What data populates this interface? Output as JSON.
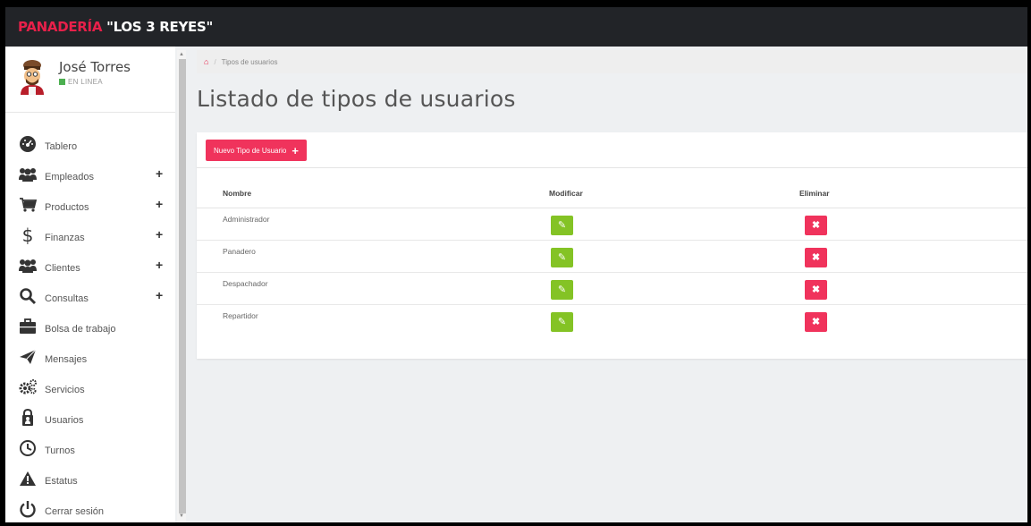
{
  "topbar": {
    "brand_part1": "PANADERÍA",
    "brand_part2": "\"LOS 3 REYES\""
  },
  "colors": {
    "brand_red": "#e8204a",
    "edit_green": "#84c325",
    "delete_red": "#f0335c",
    "topbar": "#222428"
  },
  "user": {
    "name": "José Torres",
    "status": "EN LINEA",
    "avatar_icon": "baker-avatar"
  },
  "menu": [
    {
      "label": "Tablero",
      "icon": "dashboard-icon",
      "expandable": false
    },
    {
      "label": "Empleados",
      "icon": "users-icon",
      "expandable": true
    },
    {
      "label": "Productos",
      "icon": "cart-icon",
      "expandable": true
    },
    {
      "label": "Finanzas",
      "icon": "dollar-icon",
      "expandable": true
    },
    {
      "label": "Clientes",
      "icon": "users-icon",
      "expandable": true
    },
    {
      "label": "Consultas",
      "icon": "search-icon",
      "expandable": true
    },
    {
      "label": "Bolsa de trabajo",
      "icon": "briefcase-icon",
      "expandable": false
    },
    {
      "label": "Mensajes",
      "icon": "paper-plane-icon",
      "expandable": false
    },
    {
      "label": "Servicios",
      "icon": "gears-icon",
      "expandable": false
    },
    {
      "label": "Usuarios",
      "icon": "user-lock-icon",
      "expandable": false
    },
    {
      "label": "Turnos",
      "icon": "clock-icon",
      "expandable": false
    },
    {
      "label": "Estatus",
      "icon": "warning-icon",
      "expandable": false
    },
    {
      "label": "Cerrar sesión",
      "icon": "power-icon",
      "expandable": false
    }
  ],
  "menu_plus": "+",
  "breadcrumb": {
    "current": "Tipos de usuarios"
  },
  "page": {
    "title": "Listado de tipos de usuarios"
  },
  "toolbar": {
    "new_label": "Nuevo Tipo de Usuario",
    "new_icon": "+"
  },
  "table": {
    "headers": [
      "Nombre",
      "Modificar",
      "Eliminar"
    ],
    "rows": [
      {
        "name": "Administrador"
      },
      {
        "name": "Panadero"
      },
      {
        "name": "Despachador"
      },
      {
        "name": "Repartidor"
      }
    ]
  }
}
